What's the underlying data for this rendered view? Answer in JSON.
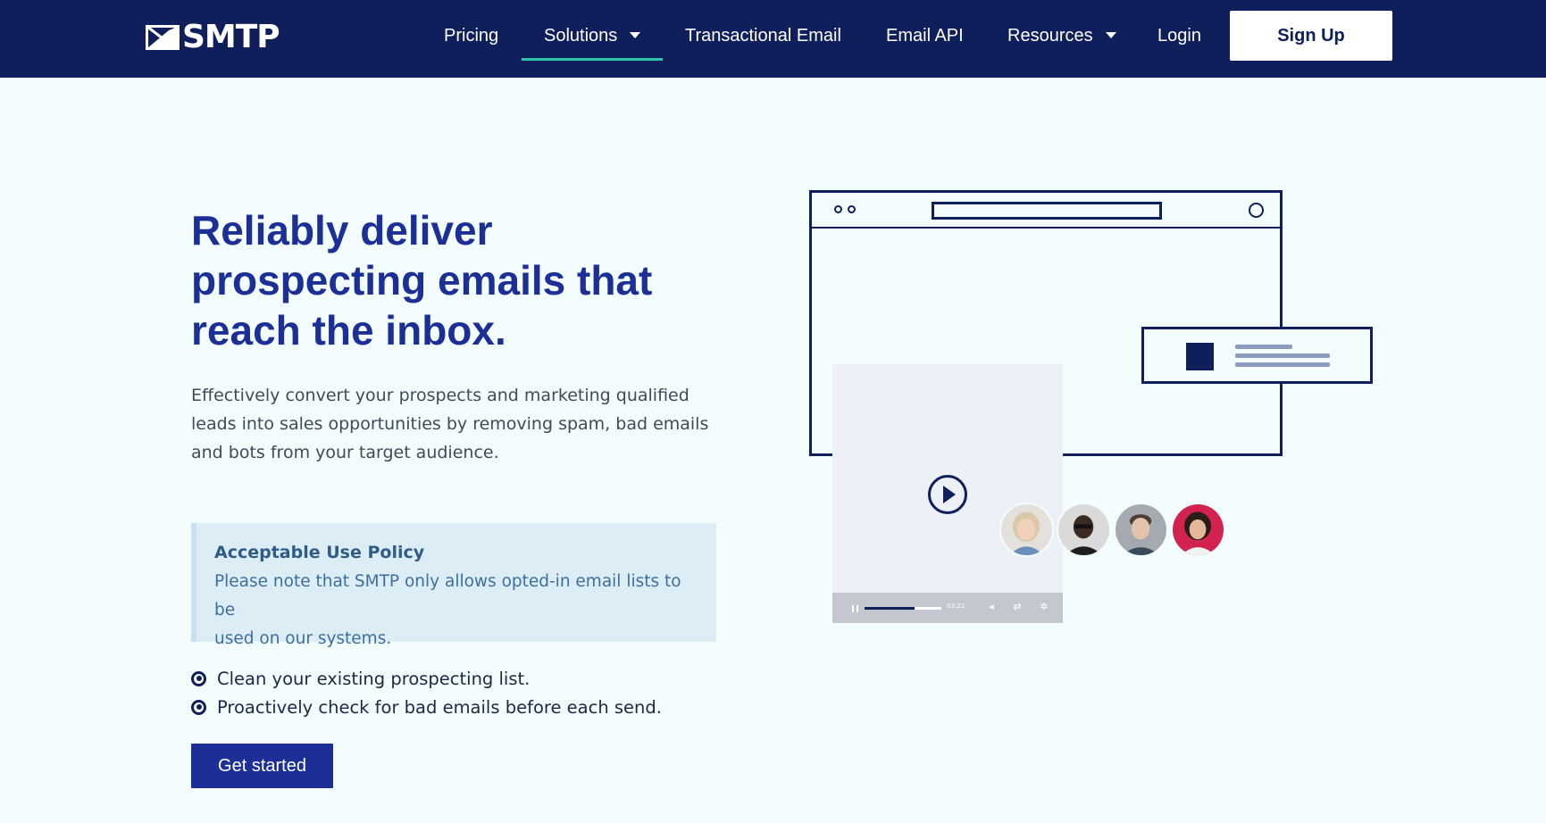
{
  "brand": {
    "name": "SMTP",
    "logo_icon": "envelope-check-icon",
    "nav_bg": "#0e1f5b",
    "accent": "#2ec4a9",
    "primary": "#1c2f96"
  },
  "nav": {
    "items": [
      {
        "label": "Pricing"
      },
      {
        "label": "Solutions",
        "has_dropdown": true,
        "active": true
      },
      {
        "label": "Transactional Email"
      },
      {
        "label": "Email API"
      },
      {
        "label": "Resources",
        "has_dropdown": true
      },
      {
        "label": "Login"
      }
    ],
    "signup_label": "Sign Up"
  },
  "hero": {
    "headline_lines": [
      "Reliably deliver",
      "prospecting emails that",
      "reach the inbox."
    ],
    "subtext_lines": [
      "Effectively convert your prospects and marketing qualified",
      "leads into sales opportunities by removing spam, bad emails",
      "and bots from your target audience."
    ],
    "policy": {
      "title": "Acceptable Use Policy",
      "body_lines": [
        "Please note that SMTP only allows opted-in email lists to be",
        "used on our systems."
      ]
    },
    "bullets": [
      "Clean your existing prospecting list.",
      "Proactively check for bad emails before each send."
    ],
    "cta_label": "Get started"
  },
  "illustration": {
    "video": {
      "time": "03:21",
      "progress": 0.65
    },
    "avatars": [
      "avatar-woman-blonde",
      "avatar-man-dark",
      "avatar-man-grey",
      "avatar-woman-red"
    ]
  }
}
